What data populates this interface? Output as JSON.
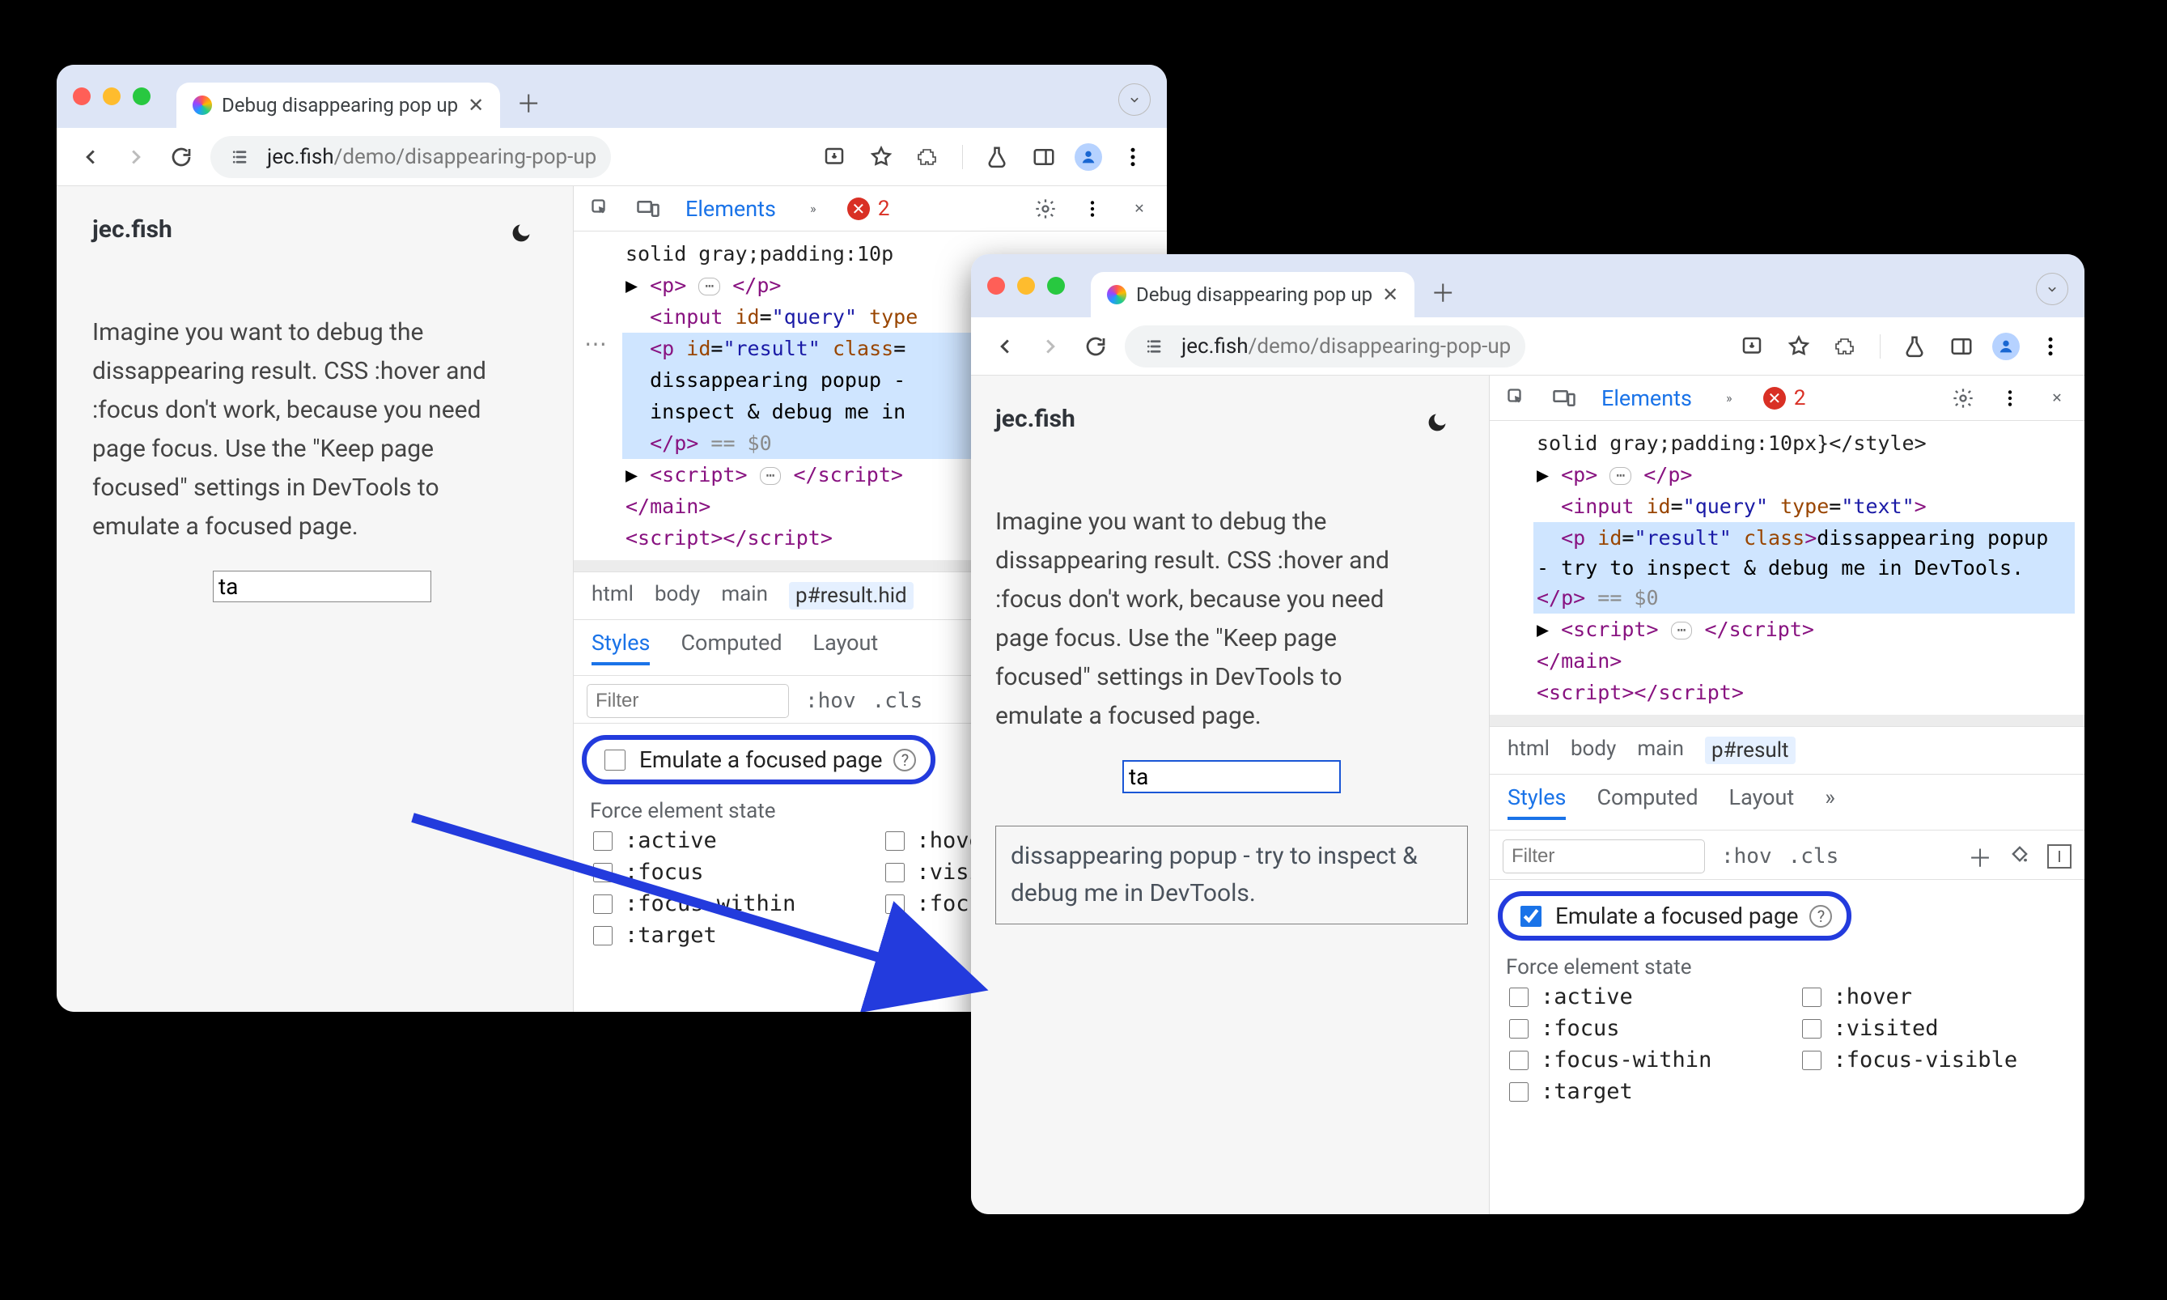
{
  "browserA": {
    "tab_title": "Debug disappearing pop up",
    "url_host": "jec.fish",
    "url_path": "/demo/disappearing-pop-up"
  },
  "pageA": {
    "brand": "jec.fish",
    "lead": "Imagine you want to debug the dissappearing result. CSS :hover and :focus don't work, because you need page focus. Use the \"Keep page focused\" settings in DevTools to emulate a focused page.",
    "query_value": "ta"
  },
  "devtoolsA": {
    "tabs": {
      "elements": "Elements",
      "error_count": "2"
    },
    "dom": {
      "style_tail": "solid gray;padding:10p",
      "p_open": "<p>",
      "p_close": "</p>",
      "input_line": "<input id=\"query\" type",
      "result_open": "<p id=\"result\" class=",
      "result_text1": "dissappearing popup -",
      "result_text2": "inspect & debug me in",
      "close_p": "</p>",
      "eq0": "== $0",
      "script_open": "<script>",
      "script_close": "</script>",
      "main_close": "</main>",
      "last_script": "<script></script>"
    },
    "crumbs": {
      "html": "html",
      "body": "body",
      "main": "main",
      "selected": "p#result.hid"
    },
    "subtabs": {
      "styles": "Styles",
      "computed": "Computed",
      "layout": "Layout"
    },
    "filter": {
      "placeholder": "Filter",
      "hov": ":hov",
      "cls": ".cls"
    },
    "emulate_label": "Emulate a focused page",
    "emulate_checked": false,
    "force_label": "Force element state",
    "states": {
      "active": ":active",
      "hover": ":hove",
      "focus": ":focus",
      "visited": ":visi",
      "focuswithin": ":focus-within",
      "focusvisible": ":focu",
      "target": ":target"
    }
  },
  "browserB": {
    "tab_title": "Debug disappearing pop up",
    "url_host": "jec.fish",
    "url_path": "/demo/disappearing-pop-up"
  },
  "pageB": {
    "brand": "jec.fish",
    "lead": "Imagine you want to debug the dissappearing result. CSS :hover and :focus don't work, because you need page focus. Use the \"Keep page focused\" settings in DevTools to emulate a focused page.",
    "query_value": "ta",
    "popup_text": "dissappearing popup - try to inspect & debug me in DevTools."
  },
  "devtoolsB": {
    "tabs": {
      "elements": "Elements",
      "error_count": "2"
    },
    "dom": {
      "style_tail": "solid gray;padding:10px}</style>",
      "p_open": "<p>",
      "p_close": "</p>",
      "input_line": "<input id=\"query\" type=\"text\">",
      "result_open": "<p id=\"result\" class>",
      "result_text": "dissappearing popup - try to inspect & debug me in DevTools.",
      "close_p": "</p>",
      "eq0": "== $0",
      "script_open": "<script>",
      "script_close": "</script>",
      "main_close": "</main>",
      "last_script": "<script></script>"
    },
    "crumbs": {
      "html": "html",
      "body": "body",
      "main": "main",
      "selected": "p#result"
    },
    "subtabs": {
      "styles": "Styles",
      "computed": "Computed",
      "layout": "Layout"
    },
    "filter": {
      "placeholder": "Filter",
      "hov": ":hov",
      "cls": ".cls"
    },
    "emulate_label": "Emulate a focused page",
    "emulate_checked": true,
    "force_label": "Force element state",
    "states": {
      "active": ":active",
      "hover": ":hover",
      "focus": ":focus",
      "visited": ":visited",
      "focuswithin": ":focus-within",
      "focusvisible": ":focus-visible",
      "target": ":target"
    }
  }
}
